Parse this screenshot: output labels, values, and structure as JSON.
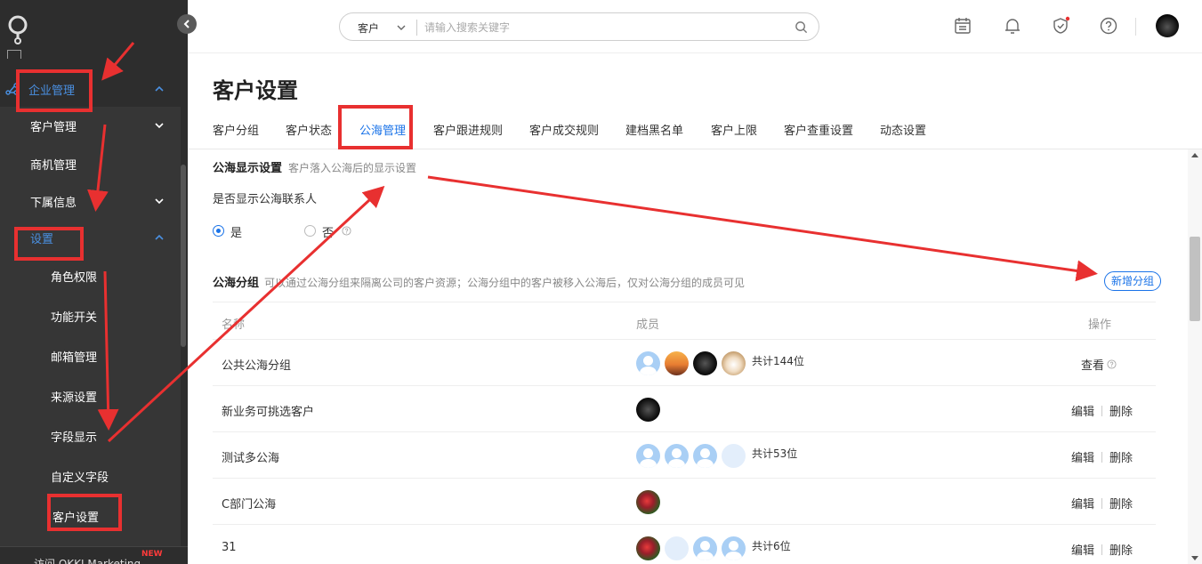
{
  "colors": {
    "accent": "#1a73e8",
    "sidebar_bg": "#2d2d2d",
    "annotation": "#e83030"
  },
  "sidebar": {
    "items": [
      {
        "label": "企业管理",
        "level": 1,
        "state": "expanded",
        "icon": "enterprise-icon",
        "active": true
      },
      {
        "label": "客户管理",
        "level": 2,
        "state": "collapsed"
      },
      {
        "label": "商机管理",
        "level": 2
      },
      {
        "label": "下属信息",
        "level": 2,
        "state": "collapsed"
      },
      {
        "label": "设置",
        "level": 2,
        "state": "expanded",
        "active": true
      },
      {
        "label": "角色权限",
        "level": 3
      },
      {
        "label": "功能开关",
        "level": 3
      },
      {
        "label": "邮箱管理",
        "level": 3
      },
      {
        "label": "来源设置",
        "level": 3
      },
      {
        "label": "字段显示",
        "level": 3
      },
      {
        "label": "自定义字段",
        "level": 3
      },
      {
        "label": "客户设置",
        "level": 3,
        "active": true
      }
    ],
    "footer_text": "访问 OKKI Marketing",
    "footer_badge": "NEW"
  },
  "header": {
    "search_scope": "客户",
    "search_placeholder": "请输入搜索关键字",
    "icons": [
      "calendar-icon",
      "bell-icon",
      "shield-check-icon",
      "help-icon"
    ]
  },
  "page": {
    "title": "客户设置",
    "tabs": [
      {
        "label": "客户分组"
      },
      {
        "label": "客户状态"
      },
      {
        "label": "公海管理",
        "active": true
      },
      {
        "label": "客户跟进规则"
      },
      {
        "label": "客户成交规则"
      },
      {
        "label": "建档黑名单"
      },
      {
        "label": "客户上限"
      },
      {
        "label": "客户查重设置"
      },
      {
        "label": "动态设置"
      }
    ]
  },
  "display_settings": {
    "title": "公海显示设置",
    "desc": "客户落入公海后的显示设置",
    "question": "是否显示公海联系人",
    "options": [
      {
        "label": "是",
        "selected": true
      },
      {
        "label": "否",
        "selected": false
      }
    ]
  },
  "groups": {
    "title": "公海分组",
    "desc": "可以通过公海分组来隔离公司的客户资源；公海分组中的客户被移入公海后，仅对公海分组的成员可见",
    "add_button": "新增分组",
    "columns": [
      "名称",
      "成员",
      "操作"
    ],
    "rows": [
      {
        "name": "公共公海分组",
        "avatars": [
          "person",
          "sunset",
          "dark",
          "dog"
        ],
        "count": "共计144位",
        "ops": [
          "查看"
        ]
      },
      {
        "name": "新业务可挑选客户",
        "avatars": [
          "dark"
        ],
        "count": "",
        "ops": [
          "编辑",
          "删除"
        ]
      },
      {
        "name": "测试多公海",
        "avatars": [
          "person",
          "person",
          "person",
          "blank"
        ],
        "count": "共计53位",
        "ops": [
          "编辑",
          "删除"
        ]
      },
      {
        "name": "C部门公海",
        "avatars": [
          "flower"
        ],
        "count": "",
        "ops": [
          "编辑",
          "删除"
        ]
      },
      {
        "name": "31",
        "avatars": [
          "flower",
          "blank",
          "person",
          "person"
        ],
        "count": "共计6位",
        "ops": [
          "编辑",
          "删除"
        ]
      }
    ]
  }
}
